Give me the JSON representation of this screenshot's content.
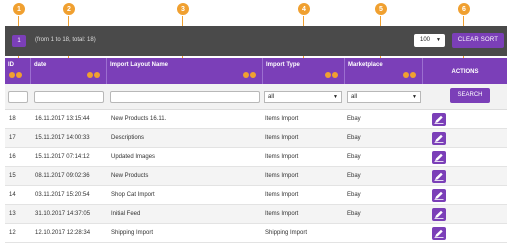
{
  "callouts": [
    "1",
    "2",
    "3",
    "4",
    "5",
    "6"
  ],
  "toolbar": {
    "page_button": "1",
    "range_text": "(from 1 to 18, total: 18)",
    "per_page_value": "100",
    "clear_sort_label": "CLEAR SORT"
  },
  "columns": {
    "id": "ID",
    "date": "date",
    "name": "Import Layout Name",
    "type": "Import Type",
    "marketplace": "Marketplace",
    "actions": "ACTIONS"
  },
  "filters": {
    "type_value": "all",
    "marketplace_value": "all",
    "search_label": "SEARCH"
  },
  "rows": [
    {
      "id": "18",
      "date": "16.11.2017 13:15:44",
      "name": "New Products 16.11.",
      "type": "Items Import",
      "marketplace": "Ebay"
    },
    {
      "id": "17",
      "date": "15.11.2017 14:00:33",
      "name": "Descriptions",
      "type": "Items Import",
      "marketplace": "Ebay"
    },
    {
      "id": "16",
      "date": "15.11.2017 07:14:12",
      "name": "Updated Images",
      "type": "Items Import",
      "marketplace": "Ebay"
    },
    {
      "id": "15",
      "date": "08.11.2017 09:02:36",
      "name": "New Products",
      "type": "Items Import",
      "marketplace": "Ebay"
    },
    {
      "id": "14",
      "date": "03.11.2017 15:20:54",
      "name": "Shop Cat Import",
      "type": "Items Import",
      "marketplace": "Ebay"
    },
    {
      "id": "13",
      "date": "31.10.2017 14:37:05",
      "name": "Initial Feed",
      "type": "Items Import",
      "marketplace": "Ebay"
    },
    {
      "id": "12",
      "date": "12.10.2017 12:28:34",
      "name": "Shipping Import",
      "type": "Shipping Import",
      "marketplace": ""
    }
  ],
  "colors": {
    "accent": "#7b3fb8",
    "toolbar_bg": "#4a4a4a",
    "callout": "#f0a030"
  }
}
